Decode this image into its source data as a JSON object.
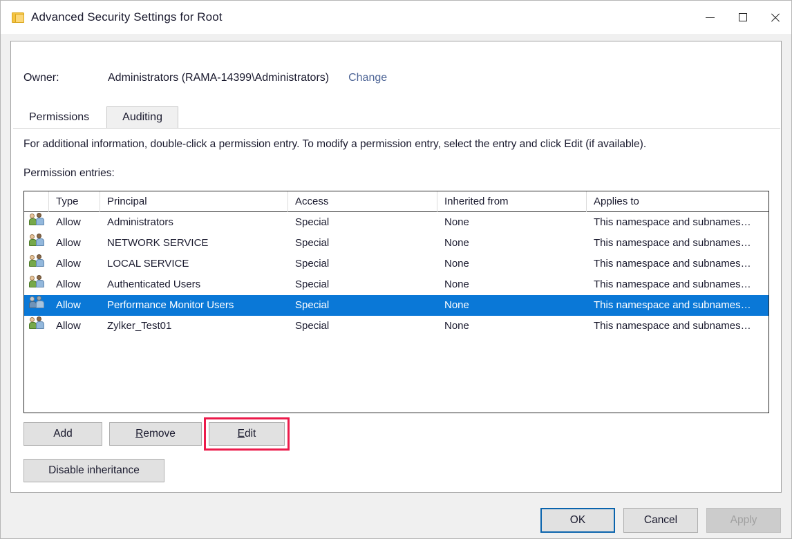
{
  "window": {
    "title": "Advanced Security Settings for Root",
    "folder_icon": "folder-icon",
    "controls": {
      "minimize": "minimize-icon",
      "maximize": "maximize-icon",
      "close": "close-icon"
    }
  },
  "owner": {
    "label": "Owner:",
    "value": "Administrators (RAMA-14399\\Administrators)",
    "change_link": "Change"
  },
  "tabs": [
    {
      "label": "Permissions",
      "active": true
    },
    {
      "label": "Auditing",
      "active": false
    }
  ],
  "info_text": "For additional information, double-click a permission entry. To modify a permission entry, select the entry and click Edit (if available).",
  "entries_label": "Permission entries:",
  "table": {
    "columns": [
      "",
      "Type",
      "Principal",
      "Access",
      "Inherited from",
      "Applies to"
    ],
    "rows": [
      {
        "icon": "users-group-icon",
        "type": "Allow",
        "principal": "Administrators",
        "access": "Special",
        "inherited": "None",
        "applies": "This namespace and subnames…",
        "selected": false
      },
      {
        "icon": "users-group-icon",
        "type": "Allow",
        "principal": "NETWORK SERVICE",
        "access": "Special",
        "inherited": "None",
        "applies": "This namespace and subnames…",
        "selected": false
      },
      {
        "icon": "users-group-icon",
        "type": "Allow",
        "principal": "LOCAL SERVICE",
        "access": "Special",
        "inherited": "None",
        "applies": "This namespace and subnames…",
        "selected": false
      },
      {
        "icon": "users-group-icon",
        "type": "Allow",
        "principal": "Authenticated Users",
        "access": "Special",
        "inherited": "None",
        "applies": "This namespace and subnames…",
        "selected": false
      },
      {
        "icon": "users-group-icon",
        "type": "Allow",
        "principal": "Performance Monitor Users",
        "access": "Special",
        "inherited": "None",
        "applies": "This namespace and subnames…",
        "selected": true
      },
      {
        "icon": "users-group-icon",
        "type": "Allow",
        "principal": "Zylker_Test01",
        "access": "Special",
        "inherited": "None",
        "applies": "This namespace and subnames…",
        "selected": false
      }
    ]
  },
  "buttons": {
    "add": "Add",
    "remove_pre": "",
    "remove_accel": "R",
    "remove_post": "emove",
    "edit_accel": "E",
    "edit_post": "dit",
    "disable_inheritance": "Disable inheritance",
    "ok": "OK",
    "cancel": "Cancel",
    "apply": "Apply"
  },
  "annotation": {
    "target": "edit-button",
    "color": "#ec1b4b"
  },
  "colors": {
    "selection": "#0a78d7",
    "link": "#4e6596",
    "annotation": "#ec1b4b",
    "window_bg": "#f0f0f0",
    "panel_bg": "#ffffff"
  }
}
